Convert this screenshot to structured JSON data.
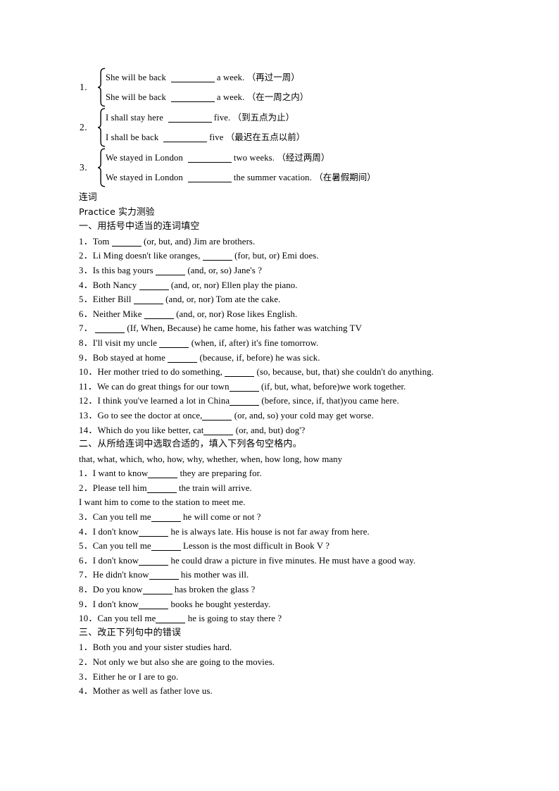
{
  "document": {
    "type": "worksheet",
    "language": "zh-CN/en",
    "background_color": "#ffffff",
    "text_color": "#000000"
  },
  "bracket_exercises": [
    {
      "number": "1.",
      "lines": [
        {
          "before": "She will be back",
          "blank_width": 62,
          "after": "a week.",
          "hint": "（再过一周）"
        },
        {
          "before": "She will be back",
          "blank_width": 62,
          "after": "a week.",
          "hint": "（在一周之内）"
        }
      ]
    },
    {
      "number": "2.",
      "lines": [
        {
          "before": "I shall stay here",
          "blank_width": 62,
          "after": "five.",
          "hint": "（到五点为止）"
        },
        {
          "before": "I shall be back",
          "blank_width": 62,
          "after": "five",
          "hint": "（最迟在五点以前）"
        }
      ]
    },
    {
      "number": "3.",
      "lines": [
        {
          "before": "We stayed in London",
          "blank_width": 62,
          "after": "two weeks.",
          "hint": "（经过两周）"
        },
        {
          "before": "We stayed in London",
          "blank_width": 62,
          "after": "the summer vacation.",
          "hint": "（在暑假期间）"
        }
      ]
    }
  ],
  "topic_title": "连词",
  "practice_title": "Practice  实力测验",
  "section_one": {
    "heading": "一、用括号中适当的连词填空",
    "items": [
      {
        "number": "1．",
        "before": "Tom ",
        "blank_width": 42,
        "after": " (or, but, and) Jim are brothers."
      },
      {
        "number": "2．",
        "before": "Li Ming doesn't like oranges, ",
        "blank_width": 42,
        "after": " (for, but, or) Emi does."
      },
      {
        "number": "3．",
        "before": "Is this bag yours ",
        "blank_width": 42,
        "after": " (and, or, so) Jane's ?"
      },
      {
        "number": "4．",
        "before": "Both Nancy ",
        "blank_width": 42,
        "after": " (and, or, nor) Ellen play the piano."
      },
      {
        "number": "5．",
        "before": "Either Bill ",
        "blank_width": 42,
        "after": " (and, or, nor) Tom ate the cake."
      },
      {
        "number": "6．",
        "before": "Neither Mike ",
        "blank_width": 42,
        "after": " (and, or, nor) Rose likes English."
      },
      {
        "number": "7．",
        "before": " ",
        "blank_width": 42,
        "after": " (If, When, Because) he came home, his father was watching TV"
      },
      {
        "number": "8．",
        "before": "I'll visit my uncle ",
        "blank_width": 42,
        "after": " (when, if, after) it's fine tomorrow."
      },
      {
        "number": "9．",
        "before": "Bob stayed at home ",
        "blank_width": 42,
        "after": " (because, if, before) he was sick."
      },
      {
        "number": "10．",
        "before": "Her mother tried to do something,  ",
        "blank_width": 42,
        "after": " (so, because, but, that) she couldn't do anything."
      },
      {
        "number": "11．",
        "before": "We can do great things for our town",
        "blank_width": 42,
        "after": " (if, but, what, before)we work together."
      },
      {
        "number": "12．",
        "before": "I think you've learned a lot in China",
        "blank_width": 42,
        "after": " (before, since, if, that)you came here."
      },
      {
        "number": "13．",
        "before": "Go to see the doctor at once,",
        "blank_width": 42,
        "after": " (or, and, so) your cold may get worse."
      },
      {
        "number": "14．",
        "before": "Which do you like better, cat",
        "blank_width": 42,
        "after": " (or, and, but) dog'?"
      }
    ]
  },
  "section_two": {
    "heading": "二、从所给连词中选取合适的，填入下列各句空格内。",
    "word_bank": "that, what, which, who, how, why, whether, when, how long, how many",
    "items": [
      {
        "number": "1．",
        "before": "I want to know",
        "blank_width": 42,
        "after": " they are preparing for."
      },
      {
        "number": "2．",
        "before": "Please tell him",
        "blank_width": 42,
        "after": " the train will arrive."
      },
      {
        "number": "",
        "before": "I want him to come to the station to meet me.",
        "blank_width": 0,
        "after": ""
      },
      {
        "number": "3．",
        "before": "Can you tell me",
        "blank_width": 42,
        "after": " he will come or not ?"
      },
      {
        "number": "4．",
        "before": "I don't know",
        "blank_width": 42,
        "after": " he is always late. His house is not far away from here."
      },
      {
        "number": "5．",
        "before": "Can you tell me",
        "blank_width": 42,
        "after": " Lesson is the most difficult in Book V ?"
      },
      {
        "number": "6．",
        "before": "I don't know",
        "blank_width": 42,
        "after": " he could draw a picture in five minutes. He must have a good way."
      },
      {
        "number": "7．",
        "before": "He didn't know",
        "blank_width": 42,
        "after": " his mother was ill."
      },
      {
        "number": "8．",
        "before": "Do you know",
        "blank_width": 42,
        "after": " has broken the glass ?"
      },
      {
        "number": "9．",
        "before": "I don't know",
        "blank_width": 42,
        "after": " books he bought yesterday."
      },
      {
        "number": "10．",
        "before": "Can you tell me",
        "blank_width": 42,
        "after": " he is going to stay there ?"
      }
    ]
  },
  "section_three": {
    "heading": "三、改正下列句中的错误",
    "items": [
      {
        "number": "1．",
        "text": "Both you and your sister studies hard."
      },
      {
        "number": "2．",
        "text": "Not only we but also she are going to the movies."
      },
      {
        "number": "3．",
        "text": "Either he or I are to go."
      },
      {
        "number": "4．",
        "text": "Mother as well as father love us."
      }
    ]
  }
}
